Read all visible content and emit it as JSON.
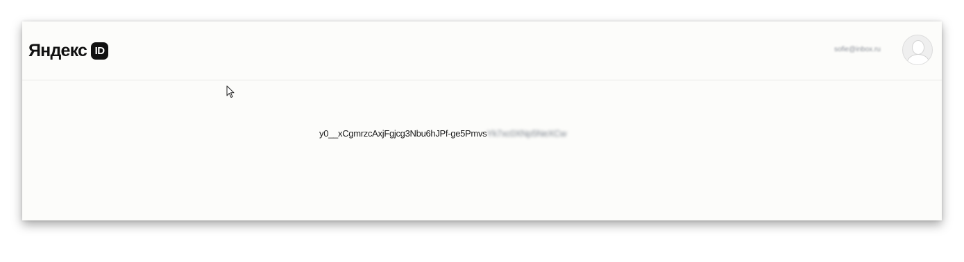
{
  "header": {
    "logo_text": "Яндекс",
    "logo_badge": "ID",
    "user_email": "sofie@inbox.ru"
  },
  "main": {
    "token_visible": "y0__xCgmrzcAxjFgjcg3Nbu6hJPf-ge5Pmvs",
    "token_hidden": "Yk7xc0XNp5NeXCw"
  },
  "icons": {
    "avatar": "user-avatar-icon",
    "cursor": "mouse-pointer-icon"
  }
}
